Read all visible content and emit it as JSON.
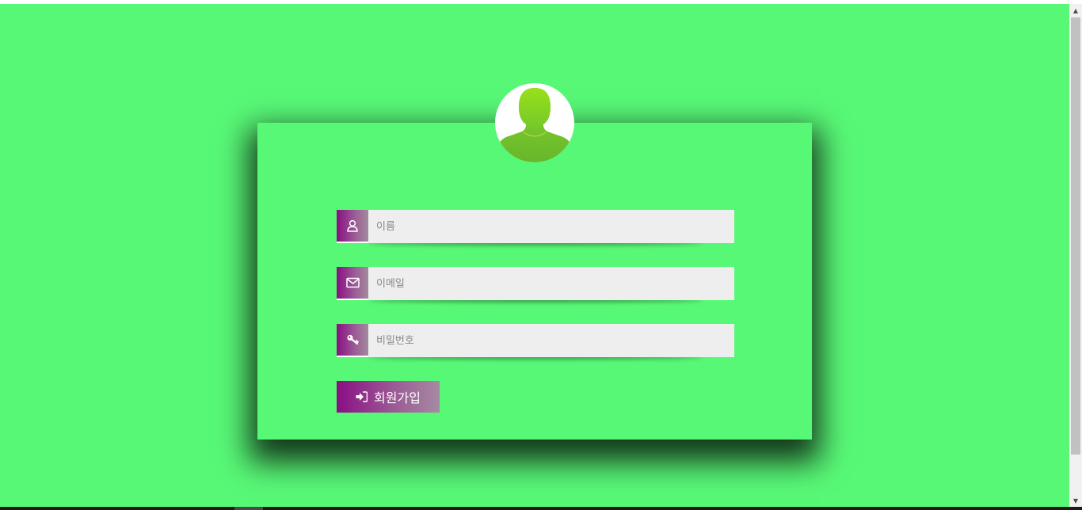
{
  "form": {
    "name_placeholder": "이름",
    "email_placeholder": "이메일",
    "password_placeholder": "비밀번호",
    "submit_label": "회원가입"
  },
  "icons": {
    "avatar": "user-silhouette-icon",
    "name": "user-icon",
    "email": "envelope-icon",
    "password": "key-icon",
    "submit": "sign-in-icon"
  },
  "colors": {
    "background": "#58f877",
    "input_background": "#eeeeee",
    "accent_start": "#8a0e83",
    "accent_end": "#a48a9f",
    "avatar_green": "#7ed321"
  }
}
